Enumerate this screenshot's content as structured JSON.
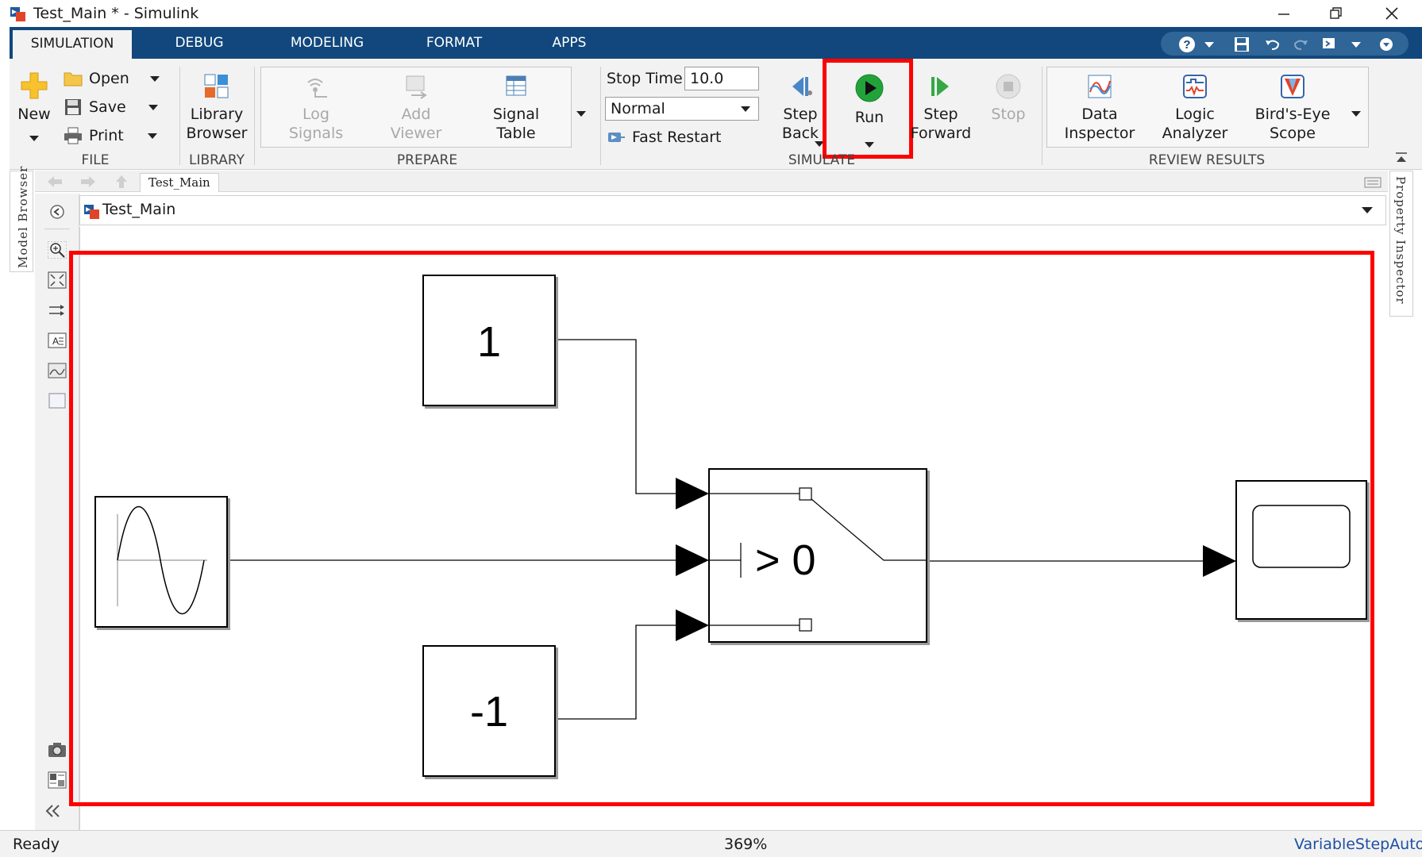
{
  "window": {
    "title": "Test_Main * - Simulink",
    "controls": [
      "minimize-icon",
      "restore-icon",
      "close-icon"
    ]
  },
  "tabs": [
    {
      "label": "SIMULATION",
      "active": true
    },
    {
      "label": "DEBUG",
      "active": false
    },
    {
      "label": "MODELING",
      "active": false
    },
    {
      "label": "FORMAT",
      "active": false
    },
    {
      "label": "APPS",
      "active": false
    }
  ],
  "quick_access": [
    "help-icon",
    "save-icon",
    "undo-icon",
    "redo-icon",
    "shortcut-icon",
    "collapse-ribbon-icon"
  ],
  "ribbon": {
    "file": {
      "label": "FILE",
      "new_label": "New",
      "open_label": "Open",
      "save_label": "Save",
      "print_label": "Print"
    },
    "library": {
      "label": "LIBRARY",
      "browser_line1": "Library",
      "browser_line2": "Browser"
    },
    "prepare": {
      "label": "PREPARE",
      "log_line1": "Log",
      "log_line2": "Signals",
      "viewer_line1": "Add",
      "viewer_line2": "Viewer",
      "table_line1": "Signal",
      "table_line2": "Table"
    },
    "simulate": {
      "label": "SIMULATE",
      "stop_time_label": "Stop Time",
      "stop_time_value": "10.0",
      "mode_value": "Normal",
      "fast_restart_label": "Fast Restart",
      "step_back_line1": "Step",
      "step_back_line2": "Back",
      "run_label": "Run",
      "step_forward_line1": "Step",
      "step_forward_line2": "Forward",
      "stop_label": "Stop"
    },
    "review": {
      "label": "REVIEW RESULTS",
      "data_line1": "Data",
      "data_line2": "Inspector",
      "logic_line1": "Logic",
      "logic_line2": "Analyzer",
      "birds_line1": "Bird's-Eye",
      "birds_line2": "Scope"
    }
  },
  "side_panels": {
    "model_browser": "Model Browser",
    "property_inspector": "Property Inspector"
  },
  "breadcrumb_tab": "Test_Main",
  "address": "Test_Main",
  "diagram": {
    "constant_top_value": "1",
    "constant_bottom_value": "-1",
    "switch_criteria": "> 0",
    "blocks": [
      "sine-wave",
      "constant",
      "constant",
      "switch",
      "scope"
    ]
  },
  "status": {
    "state": "Ready",
    "zoom": "369%",
    "solver": "VariableStepAuto"
  },
  "colors": {
    "tabstrip": "#11477c",
    "highlight": "#ff0000",
    "run_green": "#22a33a"
  }
}
